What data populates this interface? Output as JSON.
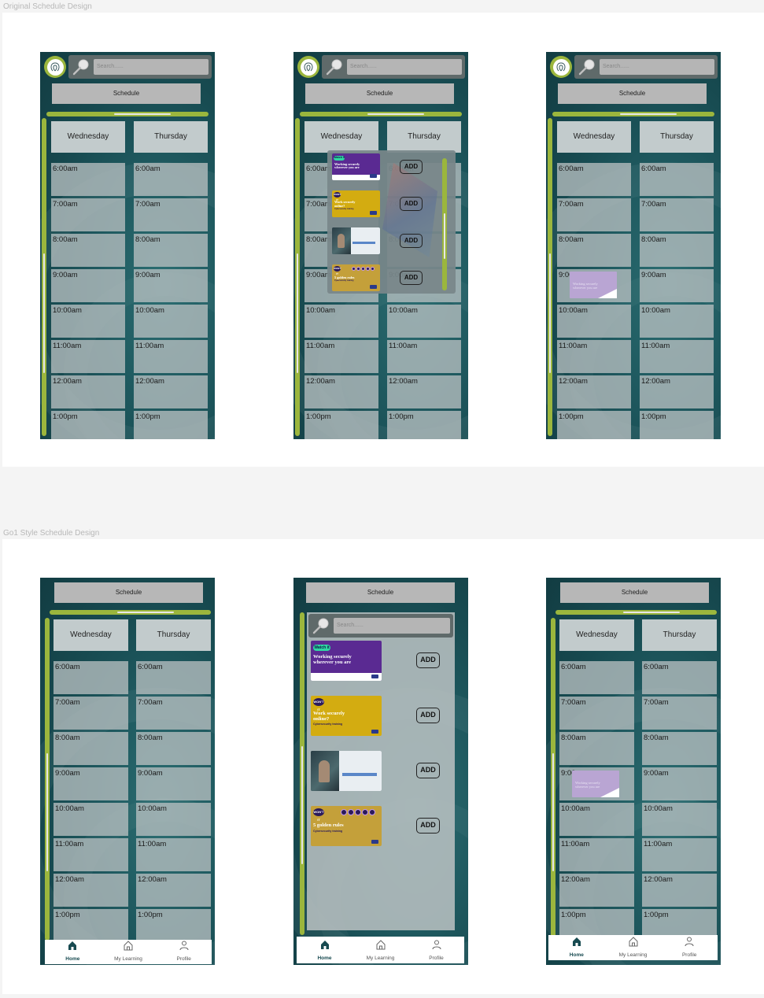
{
  "sections": [
    {
      "label": "Original Schedule Design"
    },
    {
      "label": "Go1 Style Schedule Design"
    }
  ],
  "search": {
    "placeholder": "Search......"
  },
  "schedule": {
    "label": "Schedule"
  },
  "days": [
    "Wednesday",
    "Thursday"
  ],
  "times": [
    "6:00am",
    "7:00am",
    "8:00am",
    "9:00am",
    "10:00am",
    "11:00am",
    "12:00am",
    "1:00pm"
  ],
  "nav": {
    "home": "Home",
    "learning": "My Learning",
    "profile": "Profile"
  },
  "add_label": "ADD",
  "courses": [
    {
      "title": "Working securely wherever you are",
      "tag": "Watch it",
      "bg": "#5a2a92"
    },
    {
      "title": "Work securely online?",
      "subtitle": "Cybersecurity training",
      "tag": "WON'T IT",
      "bg": "#d3ac11"
    },
    {
      "title": "",
      "bg": "#3d5d66"
    },
    {
      "title": "5 golden rules",
      "subtitle": "Cybersecurity training",
      "tag": "WON'T IT",
      "bg": "#c4a03a"
    }
  ],
  "scheduled_course": {
    "title": "Working securely wherever you are",
    "time": "9:00am",
    "day": "Wednesday"
  },
  "colors": {
    "accent": "#9bb63d",
    "teal": "#174a50",
    "slot": "#b7bfc0",
    "purple": "#5a2a92",
    "gold": "#d3ac11"
  }
}
